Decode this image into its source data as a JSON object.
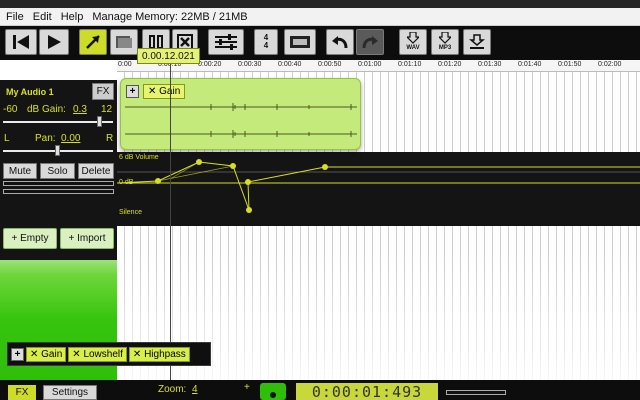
{
  "menu": {
    "items": [
      "File",
      "Edit",
      "Help",
      "Manage Memory: 22MB / 21MB"
    ]
  },
  "toolbar": {
    "prev_icon": "skip-back-icon",
    "play_icon": "play-icon",
    "select_icon": "cursor-arrow-icon",
    "split_icon": "split-clip-icon",
    "pause_icon": "pause-icon",
    "close_icon": "close-icon",
    "mixer_icon": "mixer-sliders-icon",
    "time_sig_top": "4",
    "time_sig_bottom": "4",
    "record_icon": "film-reel-icon",
    "undo_icon": "undo-icon",
    "redo_icon": "redo-icon",
    "export_wav": "WAV",
    "export_mp3": "MP3",
    "download_icon": "download-icon"
  },
  "playhead": {
    "time_tip": "0.00.12.021"
  },
  "ruler": {
    "labels": [
      "0:00",
      "0:00:10",
      "0:00:20",
      "0:00:30",
      "0:00:40",
      "0:00:50",
      "0:01:00",
      "0:01:10",
      "0:01:20",
      "0:01:30",
      "0:01:40",
      "0:01:50",
      "0:02:00"
    ]
  },
  "track": {
    "name": "My Audio 1",
    "fx_label": "FX",
    "gain_min": "-60",
    "gain_label": "dB Gain:",
    "gain_value": "0.3",
    "gain_max": "12",
    "gain_level": 0.88,
    "pan_left": "L",
    "pan_label": "Pan:",
    "pan_value": "0.00",
    "pan_right": "R",
    "pan_level": 0.5,
    "mute_label": "Mute",
    "solo_label": "Solo",
    "delete_label": "Delete",
    "add_empty_label": "+ Empty",
    "add_import_label": "+ Import"
  },
  "clip": {
    "plus": "+",
    "effect": "✕ Gain"
  },
  "automation": {
    "top_label": "6 dB Volume",
    "mid_label": "0 dB",
    "bottom_label": "Silence"
  },
  "track_fx": {
    "plus": "+",
    "effects": [
      "✕ Gain",
      "✕ Lowshelf",
      "✕ Highpass"
    ]
  },
  "bottom": {
    "fx_label": "FX",
    "settings_label": "Settings",
    "zoom_label": "Zoom:",
    "zoom_value": "4",
    "zoom_plus": "+",
    "record_icon": "record-dot-icon",
    "time_display": "0:00:01:493"
  },
  "colors": {
    "accent": "#cddc29",
    "clip": "#c3ea7a",
    "track_green": "#36c40e",
    "lcd": "#c8d83a"
  }
}
